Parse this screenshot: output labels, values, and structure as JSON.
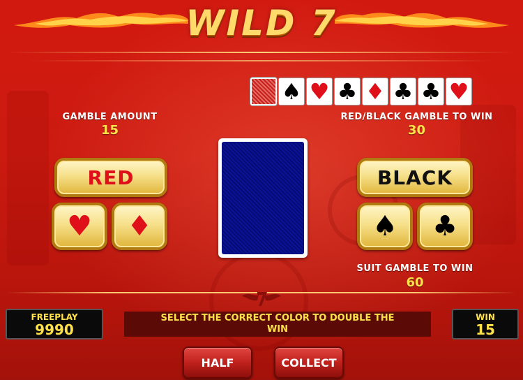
{
  "header": {
    "logo_text": "WILD 7"
  },
  "history": {
    "cards": [
      {
        "type": "back",
        "icon": "card-back-icon"
      },
      {
        "suit": "♠",
        "color": "black",
        "icon": "spade-icon"
      },
      {
        "suit": "♥",
        "color": "red",
        "icon": "heart-icon"
      },
      {
        "suit": "♣",
        "color": "black",
        "icon": "club-icon"
      },
      {
        "suit": "♦",
        "color": "red",
        "icon": "diamond-icon"
      },
      {
        "suit": "♣",
        "color": "black",
        "icon": "club-icon"
      },
      {
        "suit": "♣",
        "color": "black",
        "icon": "club-icon"
      },
      {
        "suit": "♥",
        "color": "red",
        "icon": "heart-icon"
      }
    ]
  },
  "gamble_amount": {
    "label": "GAMBLE AMOUNT",
    "value": "15"
  },
  "red_black_win": {
    "label": "RED/BLACK GAMBLE TO WIN",
    "value": "30"
  },
  "suit_win": {
    "label": "SUIT GAMBLE TO WIN",
    "value": "60"
  },
  "buttons": {
    "red": "RED",
    "black": "BLACK",
    "heart": "♥",
    "diamond": "♦",
    "spade": "♠",
    "club": "♣",
    "half": "HALF",
    "collect": "COLLECT"
  },
  "freeplay": {
    "label": "FREEPLAY",
    "value": "9990"
  },
  "win": {
    "label": "WIN",
    "value": "15"
  },
  "message": "SELECT THE CORRECT COLOR TO DOUBLE THE WIN",
  "colors": {
    "red_text": "#e0101a",
    "black_text": "#111111",
    "gold": "#ffe24a"
  }
}
